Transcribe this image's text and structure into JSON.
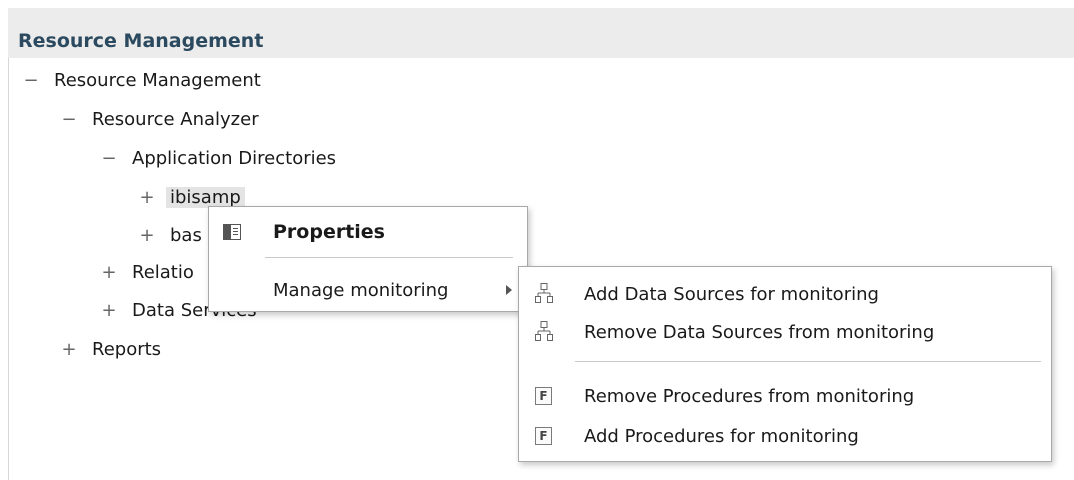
{
  "panel": {
    "title": "Resource Management"
  },
  "tree": {
    "root": {
      "label": "Resource Management",
      "toggle": "−"
    },
    "analyzer": {
      "label": "Resource Analyzer",
      "toggle": "−"
    },
    "app_dirs": {
      "label": "Application Directories",
      "toggle": "−"
    },
    "ibisamp": {
      "label": "ibisamp",
      "toggle": "+"
    },
    "base": {
      "label": "bas",
      "toggle": "+"
    },
    "relations": {
      "label": "Relatio",
      "toggle": "+"
    },
    "data_services": {
      "label": "Data Services",
      "toggle": "+"
    },
    "reports": {
      "label": "Reports",
      "toggle": "+"
    }
  },
  "context_menu": {
    "properties": {
      "label": "Properties",
      "icon": "properties-icon"
    },
    "manage_monitoring": {
      "label": "Manage monitoring",
      "icon": "submenu-arrow-icon"
    }
  },
  "submenu": {
    "items": [
      {
        "label": "Add Data Sources for monitoring",
        "icon": "hierarchy-icon"
      },
      {
        "label": "Remove Data Sources from monitoring",
        "icon": "hierarchy-icon"
      },
      {
        "label": "Remove Procedures from monitoring",
        "icon": "procedure-f-icon",
        "glyph": "F"
      },
      {
        "label": "Add Procedures for monitoring",
        "icon": "procedure-f-icon",
        "glyph": "F"
      }
    ]
  }
}
